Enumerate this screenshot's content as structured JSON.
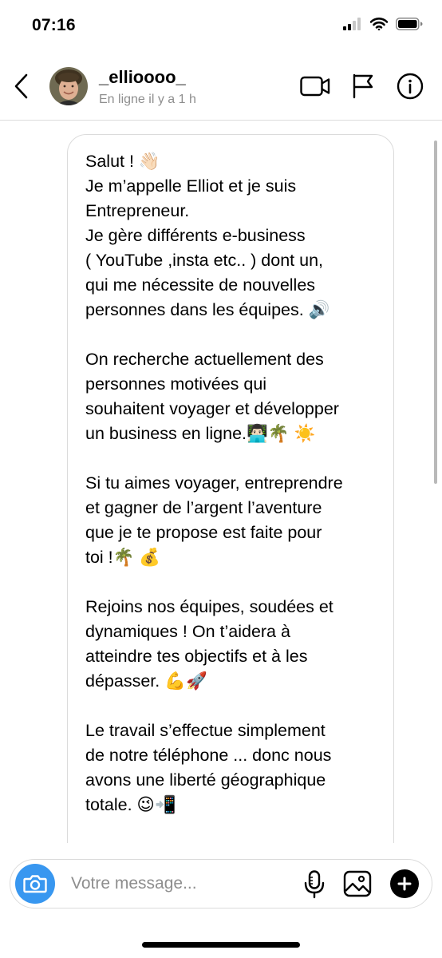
{
  "status_bar": {
    "time": "07:16"
  },
  "header": {
    "username": "_ellioooo_",
    "last_seen": "En ligne il y a 1 h",
    "icons": [
      "back-icon",
      "video-call-icon",
      "flag-icon",
      "info-icon"
    ]
  },
  "message": {
    "paragraphs": [
      {
        "lines": [
          "Salut ! 👋🏻",
          "Je m’appelle Elliot et je suis",
          "Entrepreneur.",
          "Je gère différents e-business",
          "( YouTube ,insta etc.. ) dont un,",
          "qui me nécessite de nouvelles",
          "personnes dans les équipes. 🔊"
        ]
      },
      {
        "lines": [
          "On recherche actuellement des",
          "personnes motivées qui",
          "souhaitent voyager et développer",
          "un business en ligne.👨🏻‍💻🌴 ☀️"
        ]
      },
      {
        "lines": [
          "Si tu aimes voyager, entreprendre",
          "et gagner de l’argent l’aventure",
          "que je te propose est faite pour",
          "toi !🌴 💰"
        ]
      },
      {
        "lines": [
          "Rejoins nos équipes, soudées et",
          "dynamiques ! On t’aidera à",
          "atteindre tes objectifs et à les",
          "dépasser. 💪🚀"
        ]
      },
      {
        "lines": [
          "Le travail s’effectue simplement",
          "de notre téléphone ... donc nous",
          "avons une liberté géographique",
          "totale. 😉📲"
        ]
      }
    ]
  },
  "composer": {
    "placeholder": "Votre message...",
    "icons": [
      "camera-icon",
      "microphone-icon",
      "gallery-icon",
      "plus-icon"
    ]
  },
  "colors": {
    "accent": "#3897f0",
    "muted_text": "#8e8e8e",
    "border": "#dbdbdb"
  }
}
